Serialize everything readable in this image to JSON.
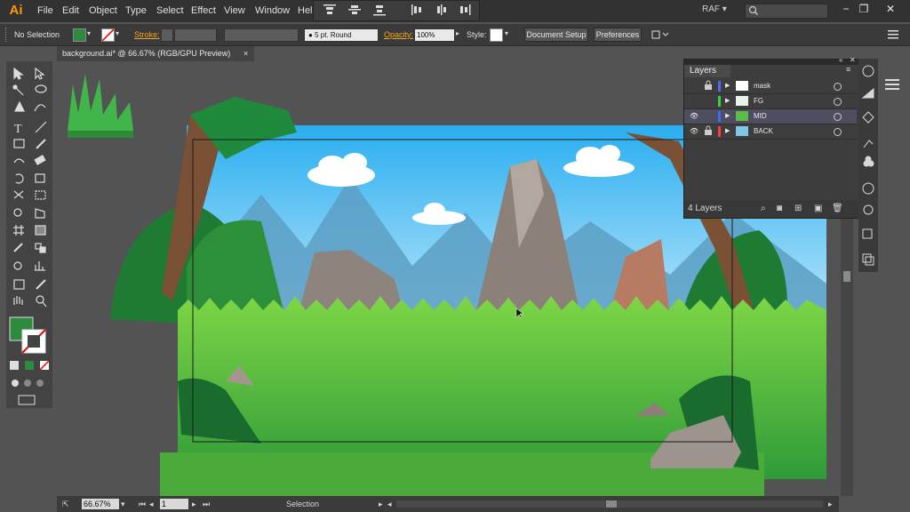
{
  "app": {
    "logo_text": "Ai",
    "brand_color": "#ff9a00"
  },
  "menu": {
    "items": [
      "File",
      "Edit",
      "Object",
      "Type",
      "Select",
      "Effect",
      "View",
      "Window",
      "Help"
    ]
  },
  "workspace": {
    "label": "RAF",
    "chevron": "▾"
  },
  "window_controls": {
    "minimize": "−",
    "restore": "❐",
    "close": "✕"
  },
  "control_bar": {
    "selection_state": "No Selection",
    "stroke_label": "Stroke:",
    "brush_label": "5 pt. Round",
    "opacity_label": "Opacity:",
    "opacity_value": "100%",
    "style_label": "Style:",
    "document_setup": "Document Setup",
    "preferences": "Preferences",
    "fill_color": "#2d8a3e"
  },
  "document_tab": {
    "title": "background.ai* @ 66.67% (RGB/GPU Preview)",
    "close": "×"
  },
  "layers_panel": {
    "title": "Layers",
    "count_label": "4 Layers",
    "layers": [
      {
        "name": "mask",
        "visible": false,
        "locked": true,
        "color": "#4f6bff",
        "selected": false
      },
      {
        "name": "FG",
        "visible": false,
        "locked": false,
        "color": "#3ad13a",
        "selected": false
      },
      {
        "name": "MID",
        "visible": true,
        "locked": false,
        "color": "#3b6cff",
        "selected": true
      },
      {
        "name": "BACK",
        "visible": true,
        "locked": true,
        "color": "#ff3b3b",
        "selected": false
      }
    ]
  },
  "status_bar": {
    "zoom": "66.67%",
    "artboard": "1",
    "mode": "Selection"
  }
}
